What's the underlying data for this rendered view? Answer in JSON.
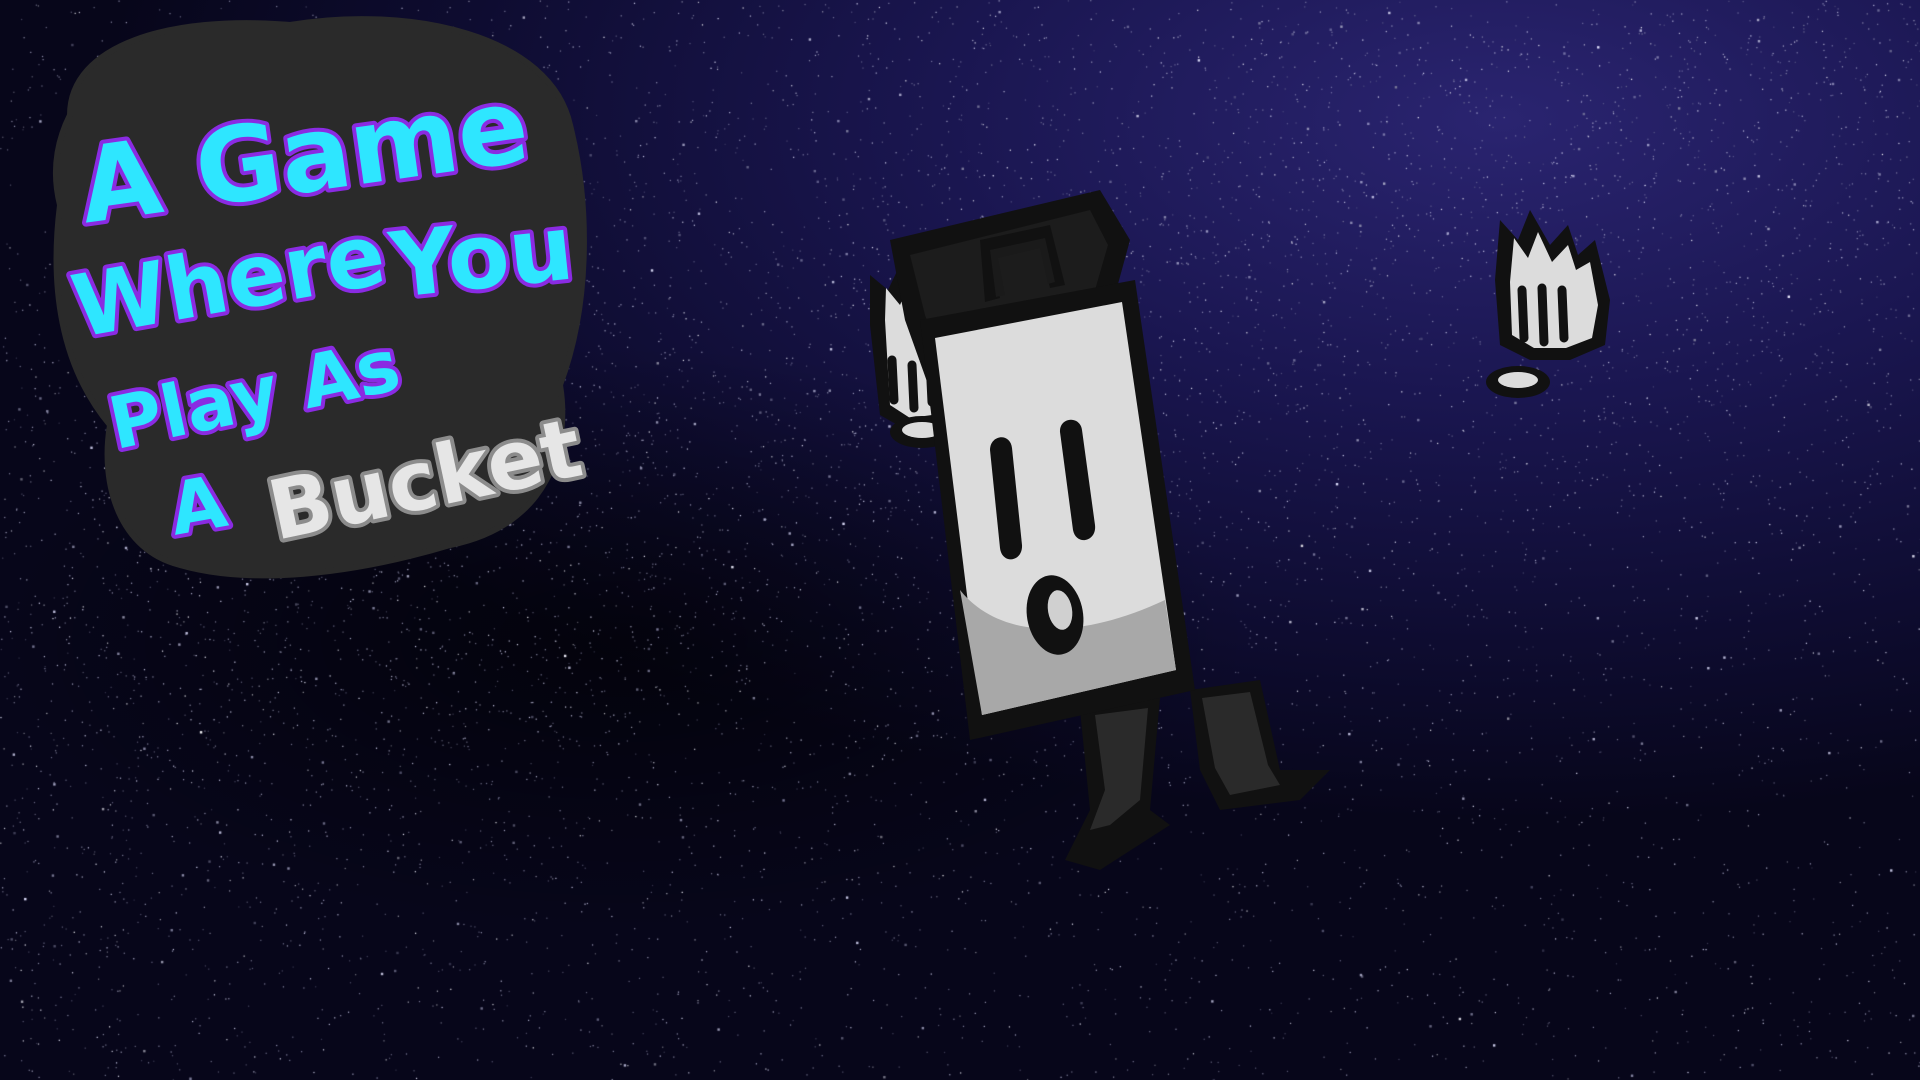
{
  "game": {
    "title_lines": [
      "A Game",
      "Where",
      "You",
      "Play As",
      "A",
      "Bucket"
    ]
  },
  "colors": {
    "title_cyan": "#2ee6ff",
    "title_purple": "#8a2be2",
    "title_white": "#e6e6e6",
    "title_gray": "#8c8c8c",
    "logo_backdrop": "#2a2a2a",
    "space_deep": "#0b0a24",
    "space_purple": "#2a2470",
    "bucket_outline": "#111111",
    "bucket_body": "#dcdcdc",
    "bucket_shade": "#a8a8a8"
  },
  "characters": {
    "player": {
      "icon": "bucket-character-icon",
      "hands": [
        "left-glove-icon",
        "right-glove-icon"
      ]
    }
  }
}
